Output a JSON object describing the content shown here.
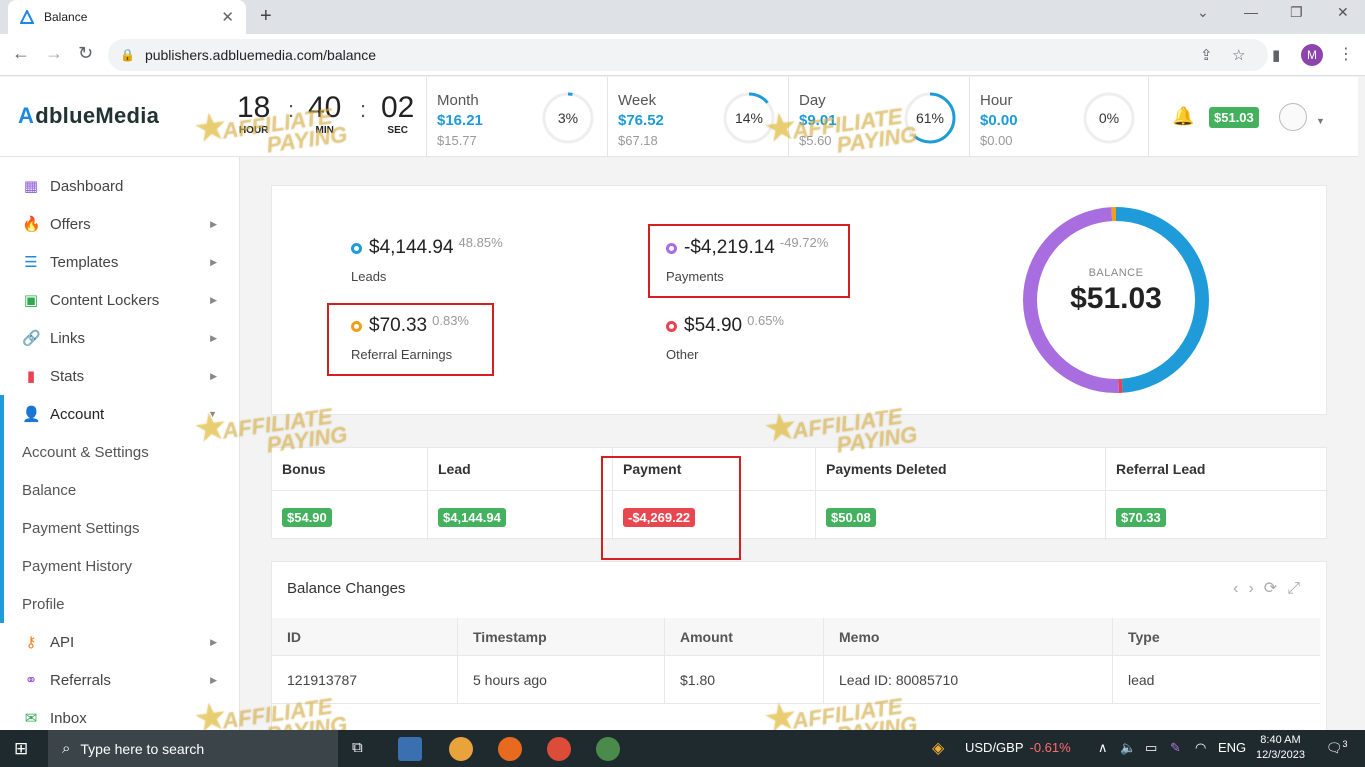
{
  "browser": {
    "tab_title": "Balance",
    "url": "publishers.adbluemedia.com/balance",
    "profile_letter": "M"
  },
  "header": {
    "logo_a": "A",
    "logo_rest": "dblueMedia",
    "clock": {
      "hour": "18",
      "hour_label": "HOUR",
      "min": "40",
      "min_label": "MIN",
      "sec": "02",
      "sec_label": "SEC"
    },
    "stats": [
      {
        "name": "Month",
        "current": "$16.21",
        "previous": "$15.77",
        "percent_label": "3%",
        "percent": 3
      },
      {
        "name": "Week",
        "current": "$76.52",
        "previous": "$67.18",
        "percent_label": "14%",
        "percent": 14
      },
      {
        "name": "Day",
        "current": "$9.01",
        "previous": "$5.60",
        "percent_label": "61%",
        "percent": 61
      },
      {
        "name": "Hour",
        "current": "$0.00",
        "previous": "$0.00",
        "percent_label": "0%",
        "percent": 0
      }
    ],
    "balance_badge": "$51.03"
  },
  "sidebar": {
    "items": [
      {
        "label": "Dashboard",
        "icon": "dashboard-icon"
      },
      {
        "label": "Offers",
        "icon": "fire-icon"
      },
      {
        "label": "Templates",
        "icon": "list-icon"
      },
      {
        "label": "Content Lockers",
        "icon": "lock-box-icon"
      },
      {
        "label": "Links",
        "icon": "link-icon"
      },
      {
        "label": "Stats",
        "icon": "bar-chart-icon"
      },
      {
        "label": "Account",
        "icon": "user-icon"
      }
    ],
    "account_sub": [
      "Account & Settings",
      "Balance",
      "Payment Settings",
      "Payment History",
      "Profile"
    ],
    "items_after": [
      {
        "label": "API",
        "icon": "key-icon"
      },
      {
        "label": "Referrals",
        "icon": "referral-icon"
      },
      {
        "label": "Inbox",
        "icon": "envelope-icon"
      }
    ]
  },
  "summary": {
    "leads": {
      "amount": "$4,144.94",
      "percent": "48.85%",
      "label": "Leads",
      "color": "#1e9bd8"
    },
    "payments": {
      "amount": "-$4,219.14",
      "percent": "-49.72%",
      "label": "Payments",
      "color": "#a86ee0"
    },
    "referral": {
      "amount": "$70.33",
      "percent": "0.83%",
      "label": "Referral Earnings",
      "color": "#f0a020"
    },
    "other": {
      "amount": "$54.90",
      "percent": "0.65%",
      "label": "Other",
      "color": "#e84350"
    },
    "donut_label": "BALANCE",
    "donut_value": "$51.03"
  },
  "totals": {
    "columns": [
      {
        "header": "Bonus",
        "value": "$54.90",
        "color": "#43b15d"
      },
      {
        "header": "Lead",
        "value": "$4,144.94",
        "color": "#43b15d"
      },
      {
        "header": "Payment",
        "value": "-$4,269.22",
        "color": "#e8474f"
      },
      {
        "header": "Payments Deleted",
        "value": "$50.08",
        "color": "#43b15d"
      },
      {
        "header": "Referral Lead",
        "value": "$70.33",
        "color": "#43b15d"
      }
    ]
  },
  "changes": {
    "title": "Balance Changes",
    "headers": [
      "ID",
      "Timestamp",
      "Amount",
      "Memo",
      "Type"
    ],
    "rows": [
      [
        "121913787",
        "5 hours ago",
        "$1.80",
        "Lead ID: 80085710",
        "lead"
      ]
    ]
  },
  "watermark": {
    "line1": "AFFILIATE",
    "line2": "PAYING"
  },
  "taskbar": {
    "search_placeholder": "Type here to search",
    "ticker_label": "USD/GBP",
    "ticker_value": "-0.61%",
    "lang": "ENG",
    "time": "8:40 AM",
    "date": "12/3/2023",
    "notif_count": "3"
  }
}
